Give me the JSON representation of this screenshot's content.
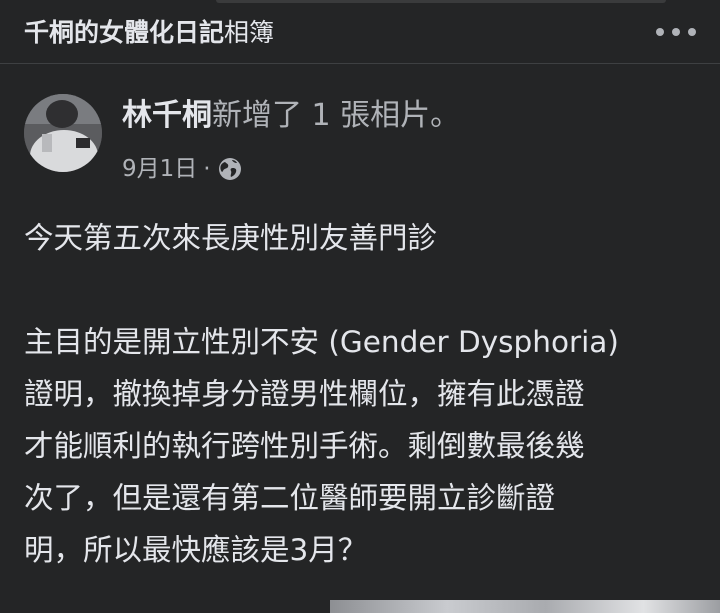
{
  "header": {
    "album_owner": "千桐的女體化日記",
    "album_suffix": "相簿"
  },
  "post": {
    "author_name": "林千桐",
    "author_action": "新增了 1 張相片。",
    "date": "9月1日",
    "meta_separator": "·",
    "privacy_icon": "globe-icon",
    "paragraph1": "今天第五次來長庚性別友善門診",
    "paragraph2_lines": [
      "主目的是開立性別不安 (Gender Dysphoria)",
      "證明，撤換掉身分證男性欄位，擁有此憑證",
      "才能順利的執行跨性別手術。剩倒數最後幾",
      "次了，但是還有第二位醫師要開立診斷證",
      "明，所以最快應該是3月？"
    ]
  },
  "colors": {
    "background": "#242526",
    "primary_text": "#e4e6eb",
    "secondary_text": "#b0b3b8",
    "divider": "#3e4042"
  }
}
